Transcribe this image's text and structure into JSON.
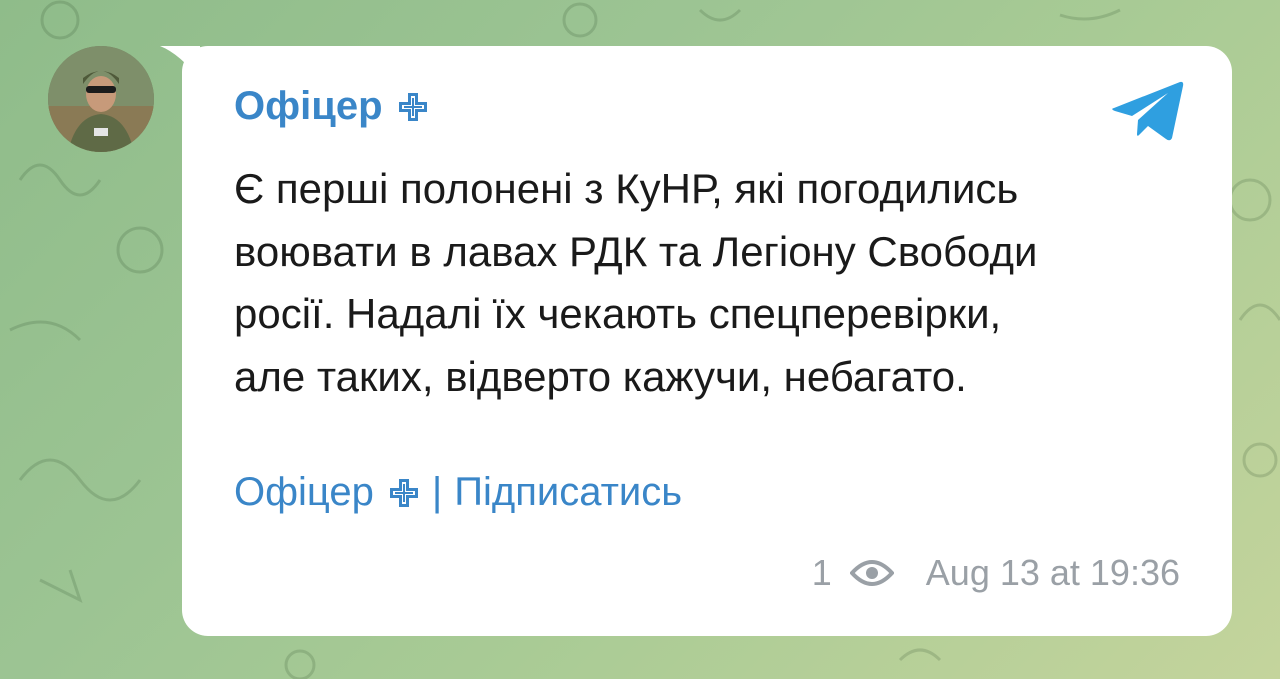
{
  "message": {
    "sender_name": "Офіцер",
    "sender_badge_icon": "cross-icon",
    "text": "Є перші полонені з КуНР, які погодились\nвоювати в лавах РДК та Легіону Свободи\nросії. Надалі їх чекають спецперевірки,\nале таких, відверто кажучи, небагато.",
    "footer": {
      "channel_name": "Офіцер",
      "separator": "|",
      "subscribe_label": "Підписатись"
    },
    "views": "1",
    "timestamp": "Aug 13 at 19:36"
  },
  "icons": {
    "app": "telegram-icon",
    "views": "eye-icon"
  },
  "colors": {
    "link": "#3a86c8",
    "telegram": "#2f9fe0",
    "text": "#1a1a1a",
    "meta": "#9aa0a6",
    "background": "#9cc493"
  }
}
